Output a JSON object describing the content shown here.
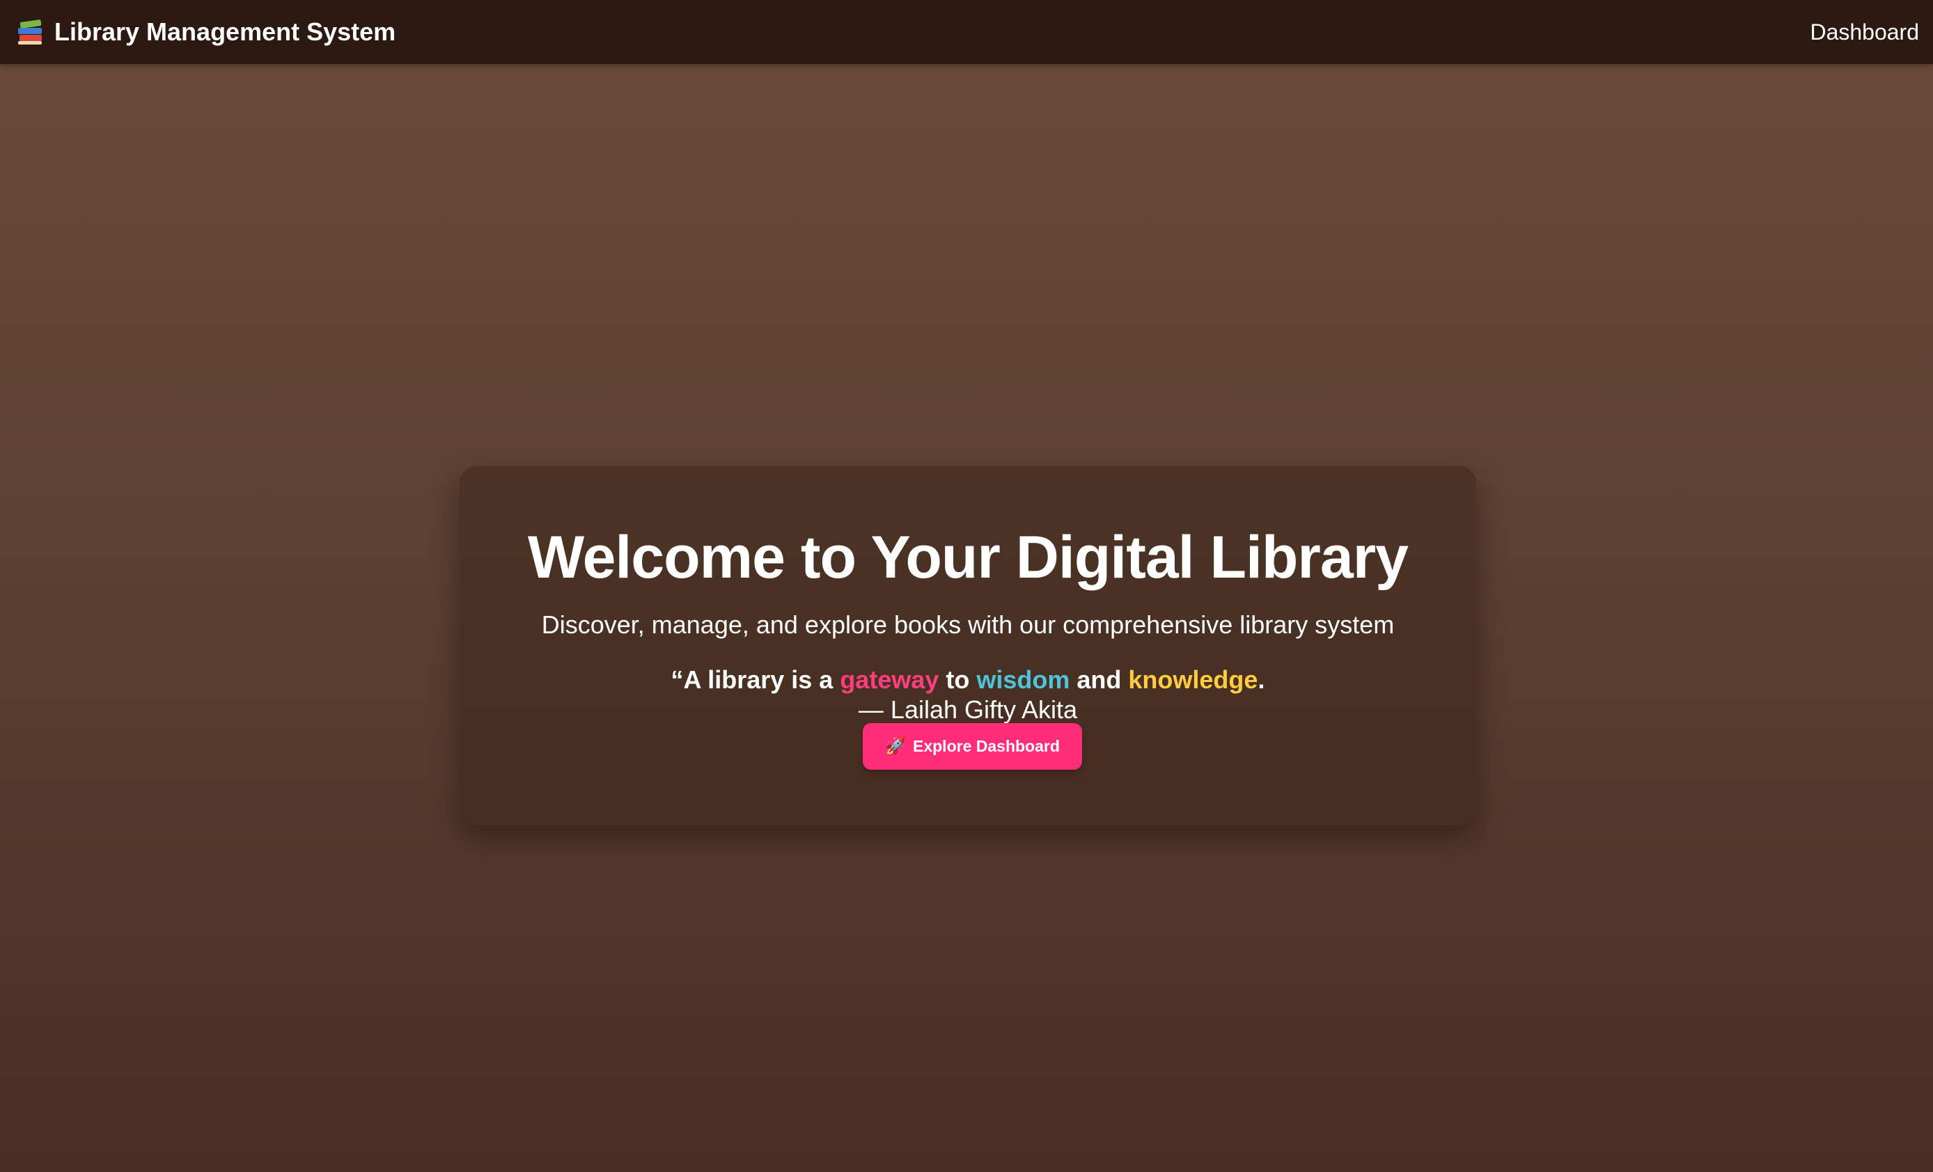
{
  "navbar": {
    "brand_icon": "books-icon",
    "brand_label": "Library Management System",
    "nav_link_label": "Dashboard"
  },
  "hero": {
    "title": "Welcome to Your Digital Library",
    "subtitle": "Discover, manage, and explore books with our comprehensive library system",
    "quote": {
      "part1": "“A library is a ",
      "highlight1": "gateway",
      "part2": " to ",
      "highlight2": "wisdom",
      "part3": " and ",
      "highlight3": "knowledge",
      "part4": "."
    },
    "author": "— Lailah Gifty Akita",
    "button": {
      "icon": "rocket-icon",
      "label": "Explore Dashboard"
    }
  },
  "colors": {
    "navbar_bg": "#2c1a12",
    "page_bg_top": "#6b4a3a",
    "page_bg_bottom": "#4a2e23",
    "accent_pink": "#ff2d78",
    "highlight_gateway": "#ff3d7f",
    "highlight_wisdom": "#4fc3d9",
    "highlight_knowledge": "#ffcc3d"
  }
}
